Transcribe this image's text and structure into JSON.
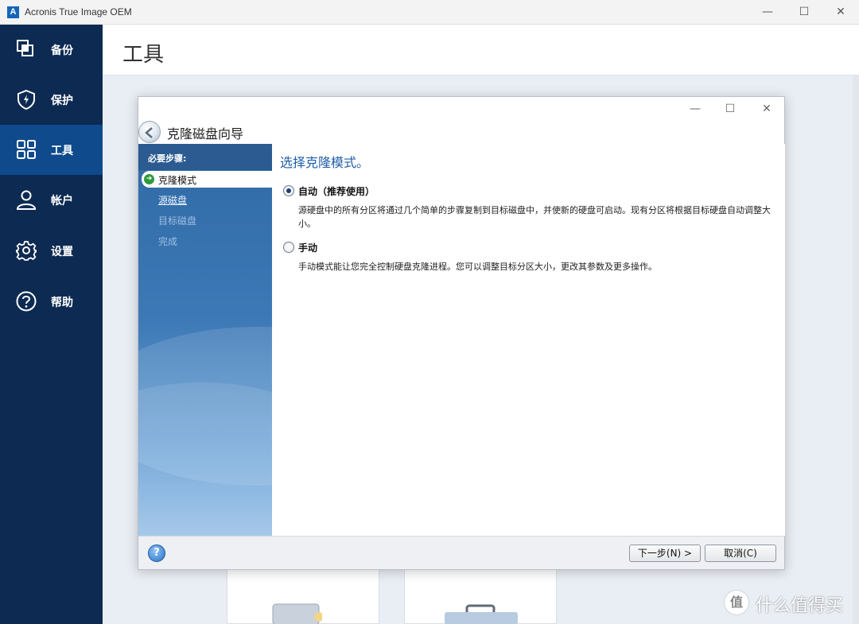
{
  "window": {
    "title": "Acronis True Image OEM",
    "logo_letter": "A",
    "minimize": "—",
    "maximize": "☐",
    "close": "✕"
  },
  "sidebar": {
    "items": [
      {
        "label": "备份",
        "icon": "backup-icon",
        "active": false
      },
      {
        "label": "保护",
        "icon": "shield-icon",
        "active": false
      },
      {
        "label": "工具",
        "icon": "tools-grid-icon",
        "active": true
      },
      {
        "label": "帐户",
        "icon": "user-icon",
        "active": false
      },
      {
        "label": "设置",
        "icon": "gear-icon",
        "active": false
      },
      {
        "label": "帮助",
        "icon": "help-icon",
        "active": false
      }
    ]
  },
  "main": {
    "title": "工具"
  },
  "dialog": {
    "title": "克隆磁盘向导",
    "minimize": "—",
    "maximize": "☐",
    "close": "✕",
    "steps_header": "必要步骤:",
    "steps": [
      {
        "label": "克隆模式",
        "state": "current"
      },
      {
        "label": "源磁盘",
        "state": "link"
      },
      {
        "label": "目标磁盘",
        "state": "disabled"
      },
      {
        "label": "完成",
        "state": "disabled"
      }
    ],
    "heading": "选择克隆模式。",
    "options": [
      {
        "label": "自动（推荐使用）",
        "checked": true,
        "description": "源硬盘中的所有分区将通过几个简单的步骤复制到目标磁盘中，并使新的硬盘可启动。现有分区将根据目标硬盘自动调整大小。"
      },
      {
        "label": "手动",
        "checked": false,
        "description": "手动模式能让您完全控制硬盘克隆进程。您可以调整目标分区大小，更改其参数及更多操作。"
      }
    ],
    "help_glyph": "?",
    "next_button": "下一步(N) >",
    "cancel_button": "取消(C)"
  },
  "watermark": {
    "text": "什么值得买",
    "logo_glyph": "值"
  },
  "colors": {
    "sidebar_bg": "#0d2a52",
    "sidebar_active": "#0f4a8c",
    "heading_blue": "#1f5fa8"
  }
}
